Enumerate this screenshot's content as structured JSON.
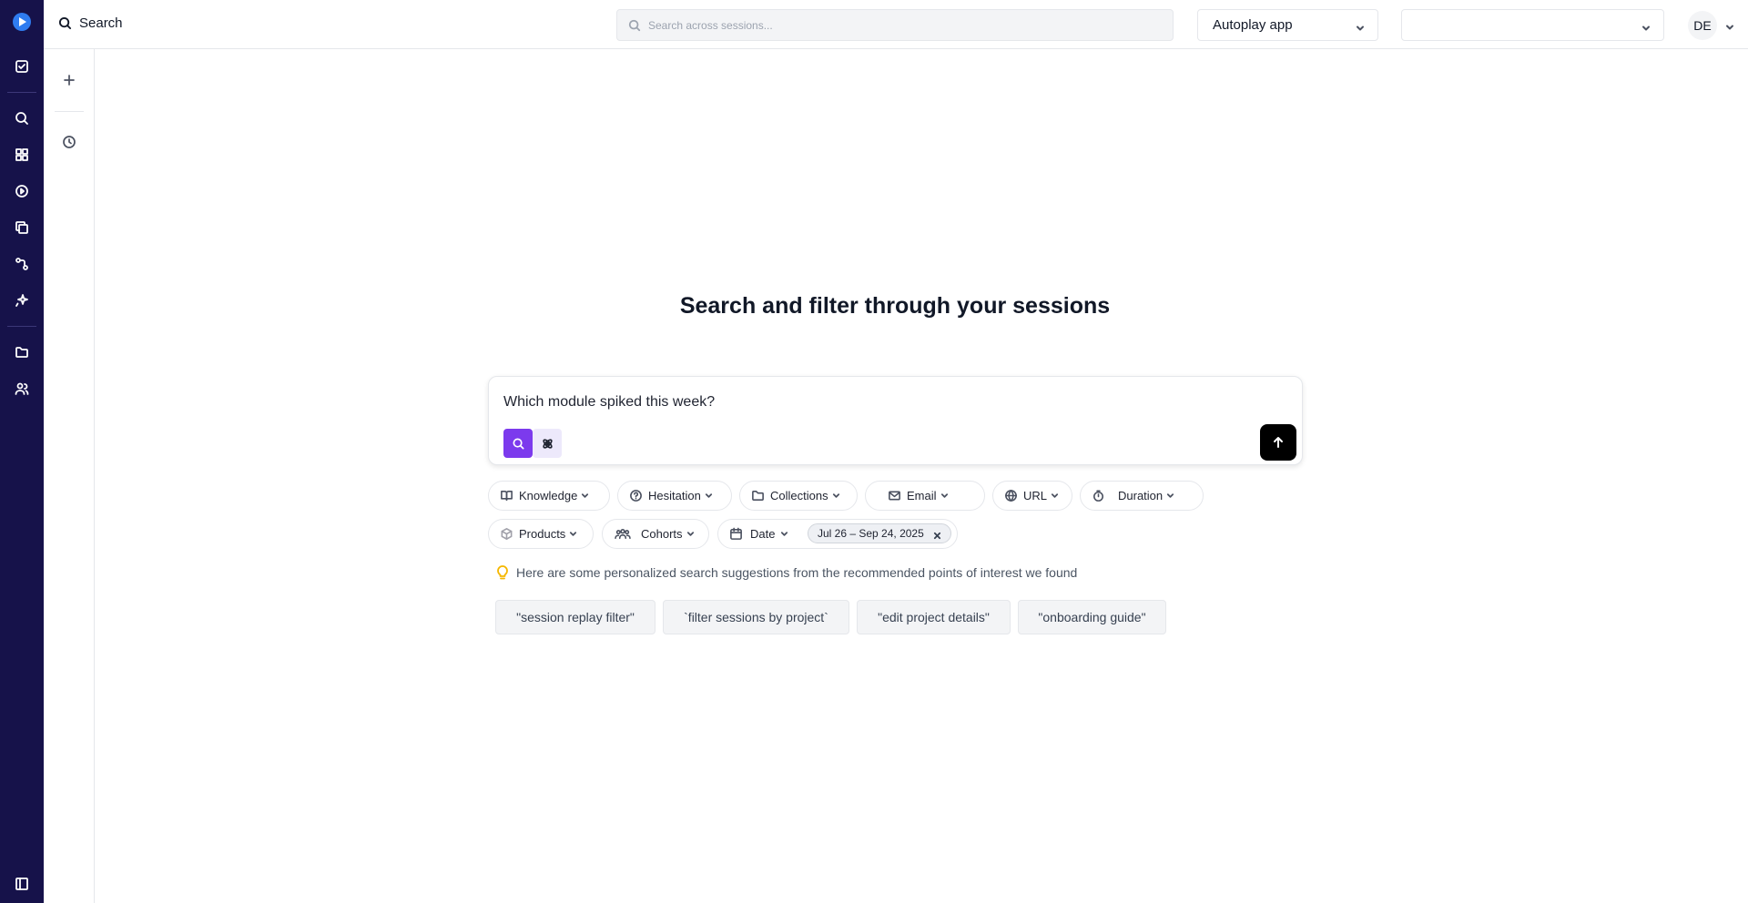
{
  "topbar": {
    "page_title": "Search",
    "search_placeholder": "Search across sessions...",
    "app_select": "Autoplay app",
    "secondary_select": "",
    "avatar_initials": "DE"
  },
  "main": {
    "headline": "Search and filter through your sessions",
    "query": "Which module spiked this week?",
    "filters_row1": [
      "Knowledge",
      "Hesitation",
      "Collections",
      "Email",
      "URL",
      "Duration"
    ],
    "filters_row2": [
      "Products",
      "Cohorts",
      "Date"
    ],
    "date_range": "Jul 26 – Sep 24, 2025",
    "suggestion_note": "Here are some personalized search suggestions from the recommended points of interest we found",
    "suggestions": [
      "\"session replay filter\"",
      "`filter sessions by project`",
      "\"edit project details\"",
      "\"onboarding guide\""
    ]
  },
  "colors": {
    "rail": "#16124a",
    "accent": "#7c3aed",
    "send": "#000000",
    "hint": "#f5b700"
  }
}
